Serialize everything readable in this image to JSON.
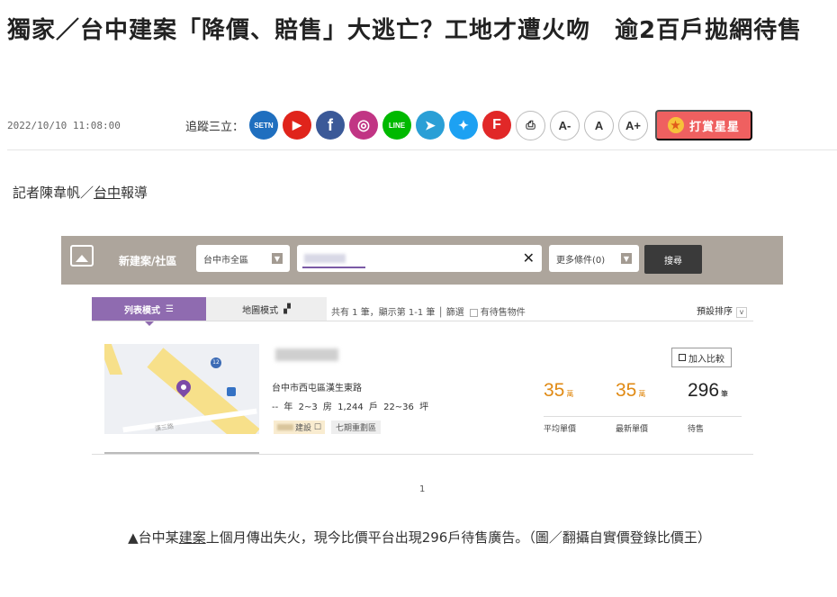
{
  "article": {
    "headline": "獨家／台中建案「降價、賠售」大逃亡？工地才遭火吻　逾2百戶拋網待售",
    "timestamp": "2022/10/10 11:08:00",
    "follow_label": "追蹤三立：",
    "byline_prefix": "記者陳韋帆／",
    "byline_link": "台中",
    "byline_suffix": "報導"
  },
  "social": [
    {
      "name": "setn",
      "label": "SETN",
      "color": "#1f6fbf"
    },
    {
      "name": "youtube",
      "label": "▶",
      "color": "#e0241b"
    },
    {
      "name": "facebook",
      "label": "f",
      "color": "#3b5998"
    },
    {
      "name": "instagram",
      "label": "◎",
      "color": "#c13584"
    },
    {
      "name": "line",
      "label": "LINE",
      "color": "#00b900"
    },
    {
      "name": "telegram",
      "label": "➤",
      "color": "#2a9fd6"
    },
    {
      "name": "twitter",
      "label": "✦",
      "color": "#1da1f2"
    },
    {
      "name": "flipboard",
      "label": "F",
      "color": "#e12828"
    }
  ],
  "controls": {
    "print": "⎙",
    "font_small": "A-",
    "font_normal": "A",
    "font_large": "A+"
  },
  "donate": {
    "label": "打賞星星",
    "star": "★"
  },
  "screenshot": {
    "bar_title": "新建案/社區",
    "region_select": "台中市全區",
    "more_conditions": "更多條件(0)",
    "search_button": "搜尋",
    "clear_icon": "✕",
    "tab_list": "列表模式",
    "tab_list_icon": "☰",
    "tab_map": "地圖模式",
    "tab_map_icon": "▞",
    "result_info": "共有 1 筆，顯示第 1-1 筆 │ 篩選",
    "for_sale_filter": "有待售物件",
    "sort_label": "預設排序",
    "sort_arrow": "v",
    "listing": {
      "address": "台中市西屯區漢生東路",
      "year": "-- 年",
      "rooms": "2~3 房",
      "households": "1,244 戶",
      "area": "22~36 坪",
      "tag_builder": "建設",
      "tag_builder_icon": "☐",
      "tag_zone": "七期重劃區",
      "compare_label": "加入比較",
      "avg_price": "35",
      "avg_price_unit": "萬",
      "avg_price_label": "平均單價",
      "latest_price": "35",
      "latest_price_unit": "萬",
      "latest_price_label": "最新單價",
      "for_sale_count": "296",
      "for_sale_unit": "筆",
      "for_sale_label": "待售",
      "map_road_label": "漢三路"
    },
    "pager": "1",
    "road_number": "12"
  },
  "caption": {
    "prefix": "▲台中某",
    "link": "建案",
    "rest": "上個月傳出失火，現今比價平台出現296戶待售廣告。（圖／翻攝自實價登錄比價王）"
  }
}
